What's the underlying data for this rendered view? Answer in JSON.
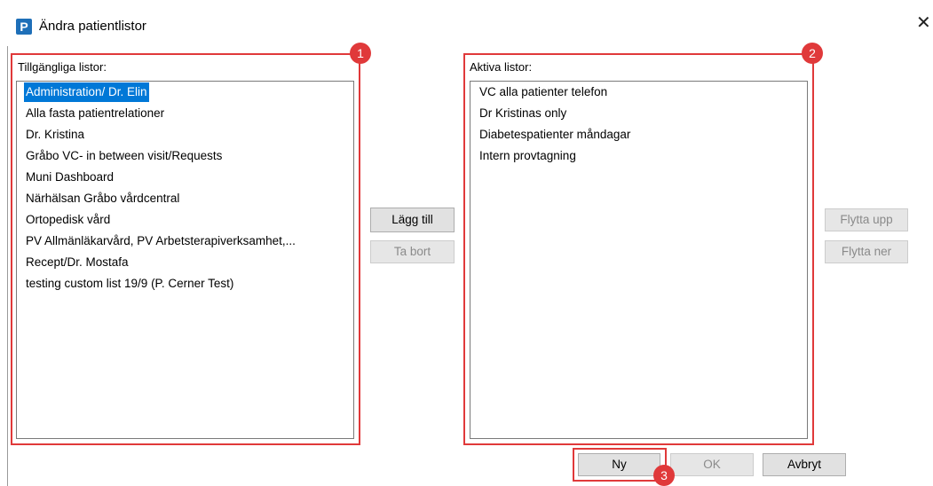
{
  "window": {
    "title": "Ändra patientlistor",
    "app_icon_letter": "P",
    "close_glyph": "✕"
  },
  "available": {
    "label": "Tillgängliga listor:",
    "items": [
      "Administration/ Dr. Elin",
      "Alla fasta patientrelationer",
      "Dr. Kristina",
      "Gråbo VC- in between visit/Requests",
      "Muni Dashboard",
      "Närhälsan Gråbo vårdcentral",
      "Ortopedisk vård",
      "PV Allmänläkarvård, PV Arbetsterapiverksamhet,...",
      "Recept/Dr. Mostafa",
      "testing custom list 19/9   (P. Cerner Test)"
    ],
    "selected": "Administration/ Dr. Elin"
  },
  "active": {
    "label": "Aktiva listor:",
    "items": [
      "VC alla patienter telefon",
      "Dr Kristinas only",
      "Diabetespatienter måndagar",
      "Intern provtagning"
    ]
  },
  "buttons": {
    "add": "Lägg till",
    "remove": "Ta bort",
    "move_up": "Flytta upp",
    "move_down": "Flytta ner",
    "new": "Ny",
    "ok": "OK",
    "cancel": "Avbryt"
  },
  "annotations": {
    "badge_1": "1",
    "badge_2": "2",
    "badge_3": "3",
    "color": "#e0393a"
  },
  "colors": {
    "selection": "#0078d7",
    "app_icon": "#1e6fb8"
  }
}
